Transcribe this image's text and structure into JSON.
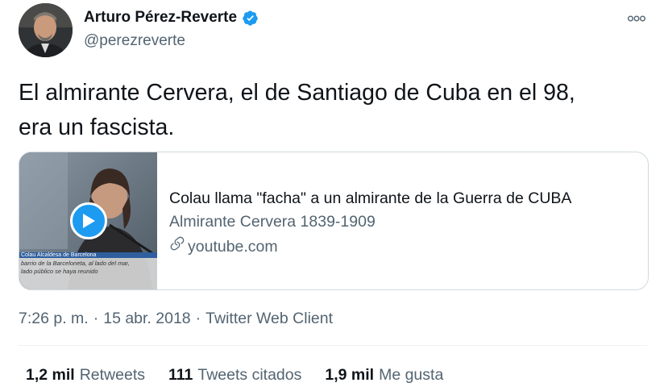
{
  "author": {
    "name": "Arturo Pérez-Reverte",
    "handle": "@perezreverte",
    "avatar_icon": "profile-photo",
    "verified_icon": "verified-badge-icon"
  },
  "more_icon": "more-options-icon",
  "more_label": "ooo",
  "tweet": {
    "line1": "El almirante Cervera, el de Santiago de Cuba en el 98,",
    "line2": "era un fascista."
  },
  "card": {
    "title": "Colau llama \"facha\" a un almirante de la Guerra de CUBA",
    "description": "Almirante Cervera 1839-1909",
    "domain": "youtube.com",
    "thumb_caption1": "Colau  Alcaldesa de Barcelona",
    "thumb_caption2": "barrio de la Barceloneta, al lado del mar,",
    "thumb_caption3": "lado público se haya reunido",
    "play_icon": "play-icon",
    "link_icon": "link-icon"
  },
  "meta": {
    "time": "7:26 p. m.",
    "sep1": "·",
    "date": "15 abr. 2018",
    "sep2": "·",
    "client": "Twitter Web Client"
  },
  "stats": [
    {
      "num": "1,2 mil",
      "label": "Retweets"
    },
    {
      "num": "111",
      "label": "Tweets citados"
    },
    {
      "num": "1,9 mil",
      "label": "Me gusta"
    }
  ],
  "colors": {
    "text": "#0f1419",
    "secondary": "#536471",
    "accent": "#1d9bf0",
    "border": "#cfd9de"
  }
}
